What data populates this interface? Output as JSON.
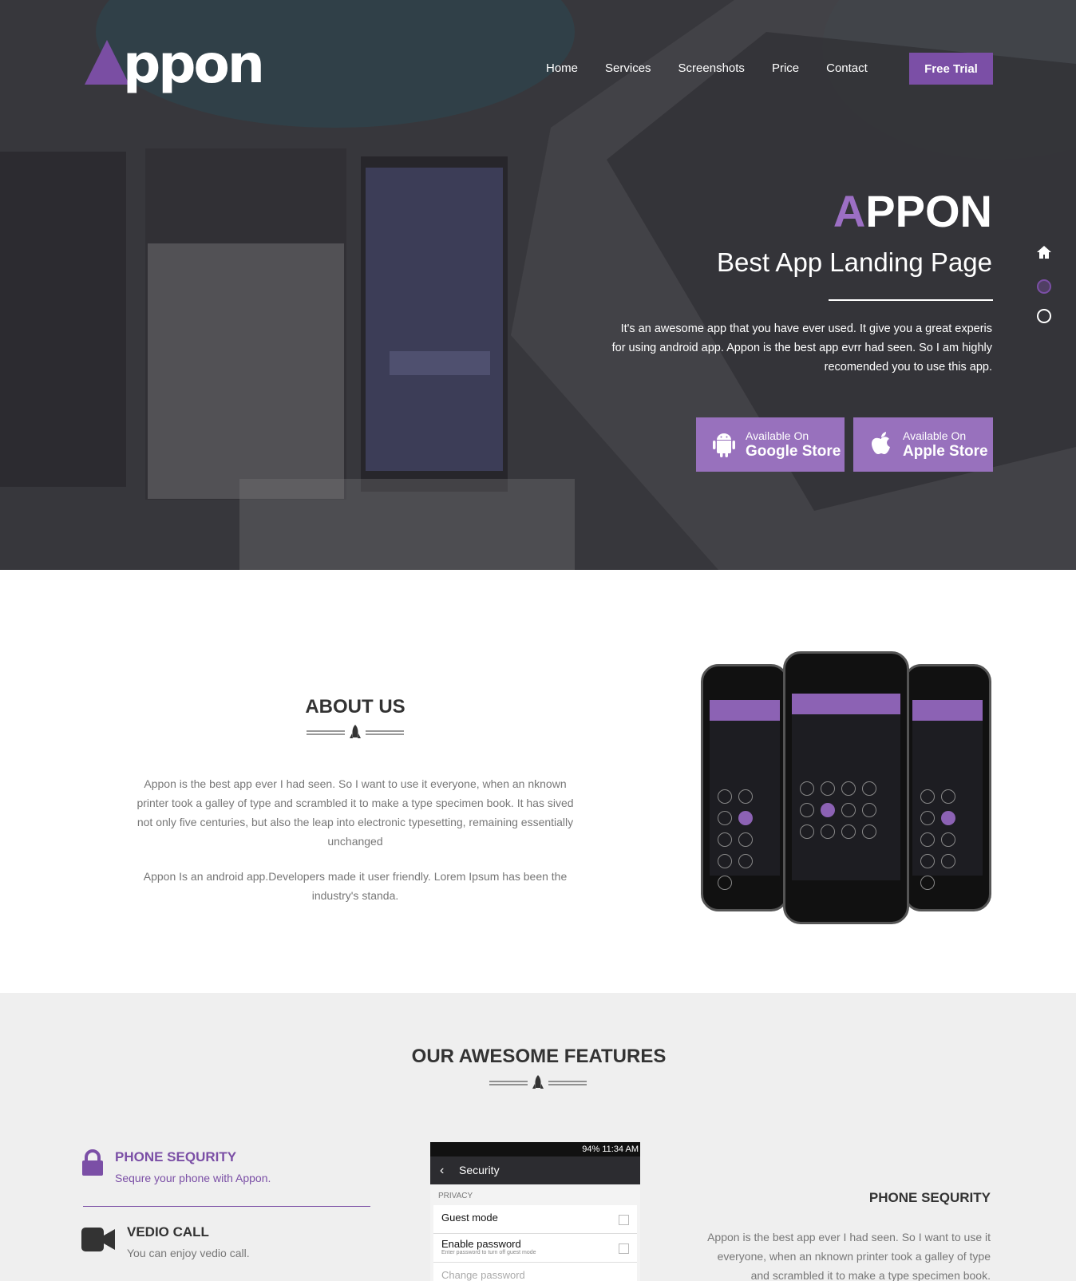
{
  "brand": {
    "logo_text": "ppon",
    "logo_mark": "A"
  },
  "nav": {
    "items": [
      "Home",
      "Services",
      "Screenshots",
      "Price",
      "Contact"
    ],
    "cta": "Free Trial"
  },
  "hero": {
    "title_first": "A",
    "title_rest": "PPON",
    "subtitle": "Best App Landing Page",
    "description": "It's an awesome app that you have ever used. It give you a great experis for using android app. Appon is the best app evrr had seen. So I am highly recomended you to use this app.",
    "google_small": "Available On",
    "google_big": "Google Store",
    "apple_small": "Available On",
    "apple_big": "Apple Store"
  },
  "about": {
    "title": "ABOUT US",
    "para1": "Appon is the best app ever I had seen. So I want to use it everyone, when an nknown printer took a galley of type and scrambled it to make a type specimen book. It has sived not only five centuries, but also the leap into electronic typesetting, remaining essentially unchanged",
    "para2": "Appon Is an android app.Developers made it user friendly. Lorem Ipsum has been the industry's standa."
  },
  "features": {
    "title": "OUR AWESOME FEATURES",
    "items": [
      {
        "title": "PHONE SEQURITY",
        "desc": "Sequre your phone with Appon."
      },
      {
        "title": "VEDIO CALL",
        "desc": "You can enjoy vedio call."
      }
    ],
    "right_title": "PHONE SEQURITY",
    "right_text": "Appon is the best app ever I had seen. So I want to use it everyone, when an nknown printer took a galley of type and scrambled it to make a type specimen book.",
    "screenshot": {
      "status": "94% 11:34 AM",
      "header": "Security",
      "category": "PRIVACY",
      "row1": "Guest mode",
      "row2": "Enable password",
      "row2_hint": "Enter password to turn off guest mode",
      "row3": "Change password"
    }
  },
  "colors": {
    "accent": "#7b4fa6",
    "accent_light": "#9871bd"
  }
}
